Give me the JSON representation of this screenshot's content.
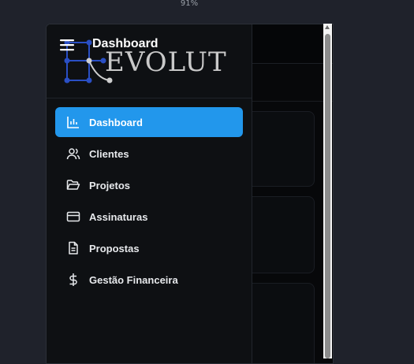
{
  "browser": {
    "zoom_label": "91%"
  },
  "app": {
    "header_title": "Dashboard",
    "brand": "EVOLUT",
    "colors": {
      "accent": "#2297ec",
      "drawer_bg": "#0e1013",
      "logo_node": "#2a4fc4"
    }
  },
  "sidebar": {
    "items": [
      {
        "label": "Dashboard",
        "icon": "bar-chart-icon",
        "active": true
      },
      {
        "label": "Clientes",
        "icon": "users-icon",
        "active": false
      },
      {
        "label": "Projetos",
        "icon": "folder-open-icon",
        "active": false
      },
      {
        "label": "Assinaturas",
        "icon": "credit-card-icon",
        "active": false
      },
      {
        "label": "Propostas",
        "icon": "file-text-icon",
        "active": false
      },
      {
        "label": "Gestão Financeira",
        "icon": "dollar-sign-icon",
        "active": false
      }
    ]
  }
}
